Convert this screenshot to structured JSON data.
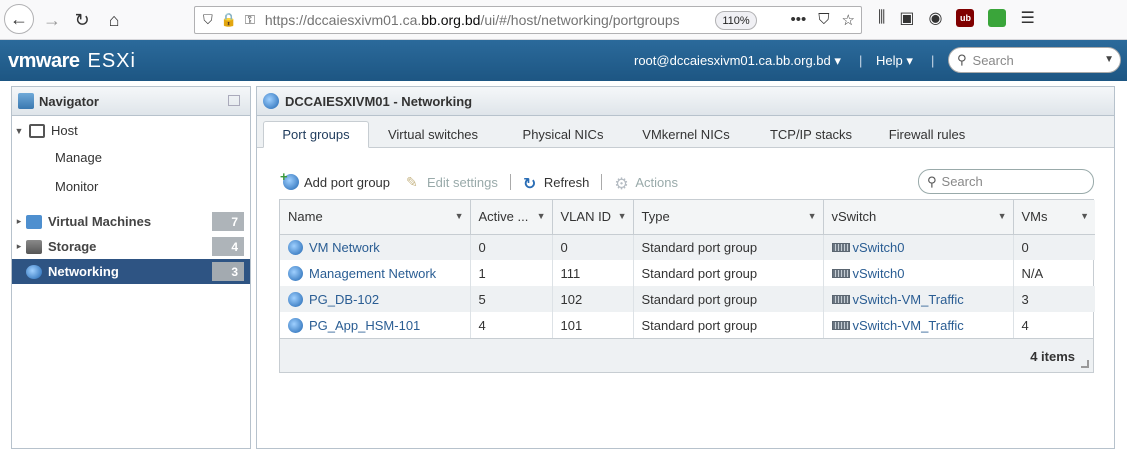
{
  "browser": {
    "url_prefix": "https://dccaiesxivm01.ca.",
    "url_domain": "bb.org.bd",
    "url_suffix": "/ui/#/host/networking/portgroups",
    "zoom": "110%"
  },
  "header": {
    "brand_vm": "vm",
    "brand_ware": "ware",
    "brand_product": "ESXi",
    "user": "root@dccaiesxivm01.ca.bb.org.bd ▾",
    "help": "Help ▾",
    "search_placeholder": "Search"
  },
  "navigator": {
    "title": "Navigator",
    "host_label": "Host",
    "manage_label": "Manage",
    "monitor_label": "Monitor",
    "items": [
      {
        "label": "Virtual Machines",
        "count": "7"
      },
      {
        "label": "Storage",
        "count": "4"
      },
      {
        "label": "Networking",
        "count": "3"
      }
    ]
  },
  "main": {
    "title": "DCCAIESXIVM01 - Networking",
    "tabs": [
      "Port groups",
      "Virtual switches",
      "Physical NICs",
      "VMkernel NICs",
      "TCP/IP stacks",
      "Firewall rules"
    ],
    "toolbar": {
      "add": "Add port group",
      "edit": "Edit settings",
      "refresh": "Refresh",
      "actions": "Actions"
    },
    "search_placeholder": "Search",
    "columns": [
      "Name",
      "Active ...",
      "VLAN ID",
      "Type",
      "vSwitch",
      "VMs"
    ],
    "rows": [
      {
        "name": "VM Network",
        "active": "0",
        "vlan": "0",
        "type": "Standard port group",
        "vswitch": "vSwitch0",
        "vms": "0"
      },
      {
        "name": "Management Network",
        "active": "1",
        "vlan": "111",
        "type": "Standard port group",
        "vswitch": "vSwitch0",
        "vms": "N/A"
      },
      {
        "name": "PG_DB-102",
        "active": "5",
        "vlan": "102",
        "type": "Standard port group",
        "vswitch": "vSwitch-VM_Traffic",
        "vms": "3"
      },
      {
        "name": "PG_App_HSM-101",
        "active": "4",
        "vlan": "101",
        "type": "Standard port group",
        "vswitch": "vSwitch-VM_Traffic",
        "vms": "4"
      }
    ],
    "footer": "4 items"
  }
}
